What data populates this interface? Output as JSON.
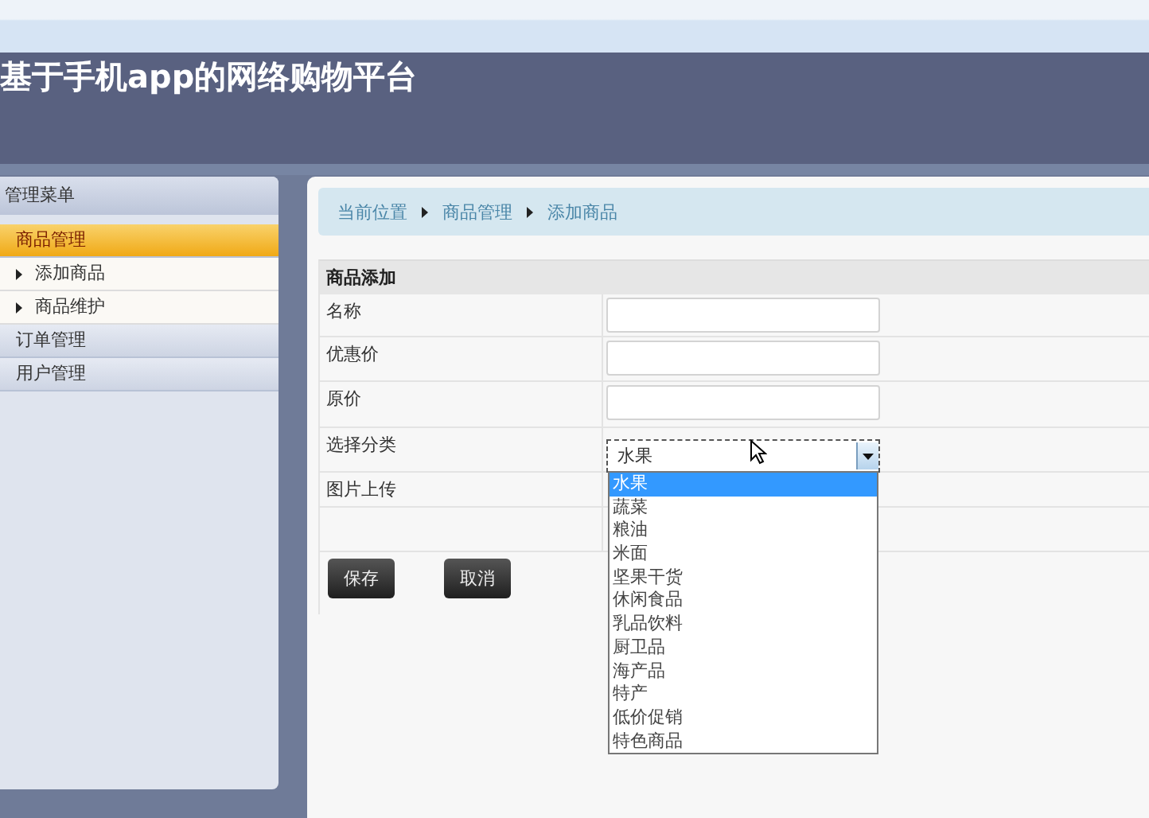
{
  "header": {
    "title": "基于手机app的网络购物平台"
  },
  "sidebar": {
    "title": "管理菜单",
    "groups": [
      {
        "label": "商品管理",
        "selected": true,
        "children": [
          {
            "label": "添加商品"
          },
          {
            "label": "商品维护"
          }
        ]
      },
      {
        "label": "订单管理",
        "selected": false
      },
      {
        "label": "用户管理",
        "selected": false
      }
    ]
  },
  "breadcrumb": [
    "当前位置",
    "商品管理",
    "添加商品"
  ],
  "form": {
    "title": "商品添加",
    "rows": [
      {
        "kind": "text",
        "label": "名称"
      },
      {
        "kind": "text",
        "label": "优惠价"
      },
      {
        "kind": "text",
        "label": "原价"
      },
      {
        "kind": "select",
        "label": "选择分类",
        "value": "水果",
        "expanded": true,
        "options": [
          {
            "label": "水果",
            "selected": true
          },
          {
            "label": "蔬菜",
            "selected": false
          },
          {
            "label": "粮油",
            "selected": false
          },
          {
            "label": "米面",
            "selected": false
          },
          {
            "label": "坚果干货",
            "selected": false
          },
          {
            "label": "休闲食品",
            "selected": false
          },
          {
            "label": "乳品饮料",
            "selected": false
          },
          {
            "label": "厨卫品",
            "selected": false
          },
          {
            "label": "海产品",
            "selected": false
          },
          {
            "label": "特产",
            "selected": false
          },
          {
            "label": "低价促销",
            "selected": false
          },
          {
            "label": "特色商品",
            "selected": false
          }
        ]
      },
      {
        "kind": "file",
        "label": "图片上传"
      }
    ],
    "buttons": [
      "保存",
      "取消"
    ]
  }
}
